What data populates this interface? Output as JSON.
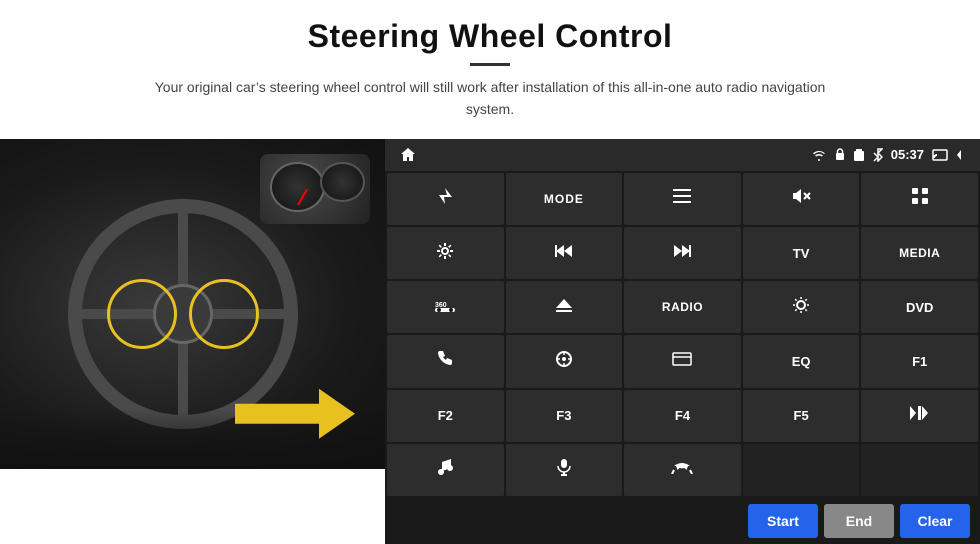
{
  "header": {
    "title": "Steering Wheel Control",
    "subtitle": "Your original car’s steering wheel control will still work after installation of this all-in-one auto radio navigation system."
  },
  "status_bar": {
    "time": "05:37",
    "icons": [
      "wifi",
      "lock",
      "sim",
      "bluetooth",
      "screen",
      "back"
    ]
  },
  "grid_buttons": [
    {
      "id": "navigate",
      "type": "icon",
      "icon": "send",
      "label": ""
    },
    {
      "id": "mode",
      "type": "text",
      "label": "MODE"
    },
    {
      "id": "menu",
      "type": "icon",
      "icon": "menu-lines",
      "label": ""
    },
    {
      "id": "vol-mute",
      "type": "icon",
      "icon": "vol-mute",
      "label": ""
    },
    {
      "id": "apps",
      "type": "icon",
      "icon": "apps-grid",
      "label": ""
    },
    {
      "id": "settings",
      "type": "icon",
      "icon": "settings",
      "label": ""
    },
    {
      "id": "prev",
      "type": "icon",
      "icon": "prev",
      "label": ""
    },
    {
      "id": "next",
      "type": "icon",
      "icon": "next",
      "label": ""
    },
    {
      "id": "tv",
      "type": "text",
      "label": "TV"
    },
    {
      "id": "media",
      "type": "text",
      "label": "MEDIA"
    },
    {
      "id": "360",
      "type": "icon",
      "icon": "car360",
      "label": ""
    },
    {
      "id": "eject",
      "type": "icon",
      "icon": "eject",
      "label": ""
    },
    {
      "id": "radio",
      "type": "text",
      "label": "RADIO"
    },
    {
      "id": "brightness",
      "type": "icon",
      "icon": "sun",
      "label": ""
    },
    {
      "id": "dvd",
      "type": "text",
      "label": "DVD"
    },
    {
      "id": "phone",
      "type": "icon",
      "icon": "phone",
      "label": ""
    },
    {
      "id": "nav",
      "type": "icon",
      "icon": "nav",
      "label": ""
    },
    {
      "id": "window",
      "type": "icon",
      "icon": "window",
      "label": ""
    },
    {
      "id": "eq",
      "type": "text",
      "label": "EQ"
    },
    {
      "id": "f1",
      "type": "text",
      "label": "F1"
    },
    {
      "id": "f2",
      "type": "text",
      "label": "F2"
    },
    {
      "id": "f3",
      "type": "text",
      "label": "F3"
    },
    {
      "id": "f4",
      "type": "text",
      "label": "F4"
    },
    {
      "id": "f5",
      "type": "text",
      "label": "F5"
    },
    {
      "id": "playpause",
      "type": "icon",
      "icon": "playpause",
      "label": ""
    },
    {
      "id": "music",
      "type": "icon",
      "icon": "music",
      "label": ""
    },
    {
      "id": "mic",
      "type": "icon",
      "icon": "mic",
      "label": ""
    },
    {
      "id": "call-end",
      "type": "icon",
      "icon": "call-end",
      "label": ""
    },
    {
      "id": "empty1",
      "type": "empty",
      "label": ""
    },
    {
      "id": "empty2",
      "type": "empty",
      "label": ""
    }
  ],
  "bottom_bar": {
    "start_label": "Start",
    "end_label": "End",
    "clear_label": "Clear"
  }
}
